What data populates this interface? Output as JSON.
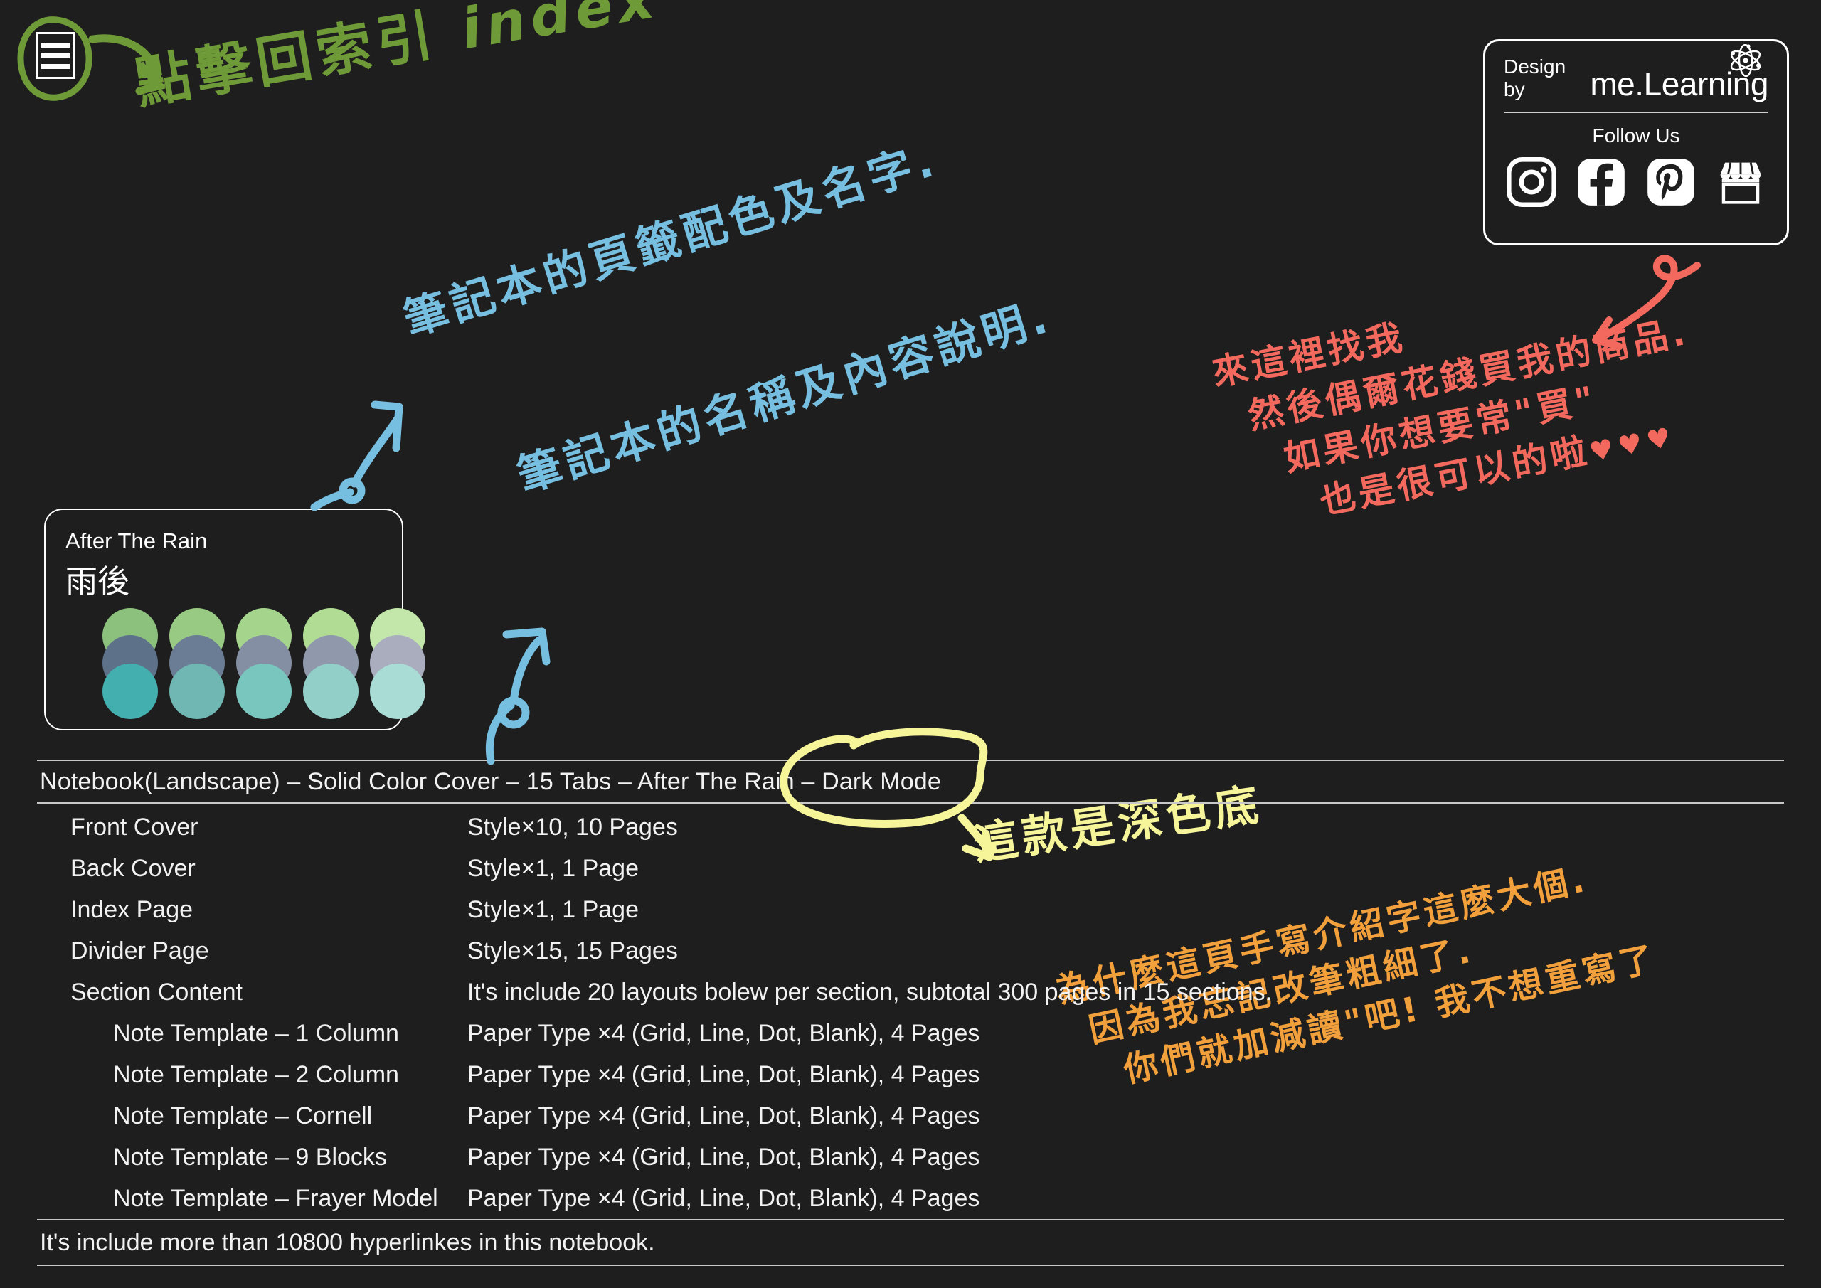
{
  "index_button": {
    "name": "index-menu-button",
    "bars": 3
  },
  "annotations": {
    "green": {
      "text": "點擊回索引 ",
      "en": "index",
      "color": "#6f9a38"
    },
    "blue_1": {
      "text": "筆記本的頁籤配色及名字.",
      "color": "#76bfe0"
    },
    "blue_2": {
      "text": "筆記本的名稱及內容說明.",
      "color": "#76bfe0"
    },
    "red": {
      "color": "#f4695e",
      "lines": [
        "來這裡找我",
        "然後偶爾花錢買我的商品.",
        "如果你想要常\"買\"",
        "也是很可以的啦"
      ],
      "hearts": "♥♥♥"
    },
    "yellow": {
      "text": "這款是深色底",
      "color": "#f6f59a"
    },
    "orange": {
      "color": "#f2a03c",
      "lines": [
        "為什麼這頁手寫介紹字這麼大個.",
        "因為我忘記改筆粗細了.",
        "你們就加減讀\"吧! 我不想重寫了"
      ]
    }
  },
  "brand": {
    "design_by": "Design by",
    "name": "me.Learning",
    "follow_us": "Follow Us",
    "socials": [
      "instagram-icon",
      "facebook-icon",
      "pinterest-icon",
      "storefront-icon"
    ]
  },
  "palette": {
    "name_en": "After The Rain",
    "name_zh": "雨後",
    "columns": [
      {
        "top": "#8cc07d",
        "mid": "#5d7289",
        "bottom": "#43afaf"
      },
      {
        "top": "#99ca84",
        "mid": "#6b7d94",
        "bottom": "#70b6b2"
      },
      {
        "top": "#a5d48c",
        "mid": "#848fa4",
        "bottom": "#79c6bf"
      },
      {
        "top": "#b0dc94",
        "mid": "#9099ab",
        "bottom": "#92cfc9"
      },
      {
        "top": "#c3e6ab",
        "mid": "#a9adbe",
        "bottom": "#aadcd6"
      }
    ]
  },
  "spec": {
    "title": "Notebook(Landscape) – Solid Color Cover – 15 Tabs – After The Rain – Dark Mode",
    "rows": [
      {
        "level": 1,
        "key": "Front Cover",
        "value": "Style×10, 10 Pages"
      },
      {
        "level": 1,
        "key": "Back Cover",
        "value": "Style×1, 1 Page"
      },
      {
        "level": 1,
        "key": "Index Page",
        "value": "Style×1, 1 Page"
      },
      {
        "level": 1,
        "key": "Divider Page",
        "value": "Style×15, 15 Pages"
      },
      {
        "level": 1,
        "key": "Section Content",
        "value": "It's include 20 layouts bolew per section, subtotal 300 pages in 15 sections."
      },
      {
        "level": 2,
        "key": "Note Template – 1 Column",
        "value": "Paper Type ×4 (Grid, Line, Dot, Blank), 4 Pages"
      },
      {
        "level": 2,
        "key": "Note Template – 2 Column",
        "value": "Paper Type ×4 (Grid, Line, Dot, Blank), 4 Pages"
      },
      {
        "level": 2,
        "key": "Note Template – Cornell",
        "value": "Paper Type ×4 (Grid, Line, Dot, Blank), 4 Pages"
      },
      {
        "level": 2,
        "key": "Note Template – 9 Blocks",
        "value": "Paper Type ×4 (Grid, Line, Dot, Blank), 4 Pages"
      },
      {
        "level": 2,
        "key": "Note Template – Frayer Model",
        "value": "Paper Type ×4 (Grid, Line, Dot, Blank), 4 Pages"
      }
    ],
    "footer": "It's include more than 10800 hyperlinkes in this notebook."
  },
  "theme": {
    "background": "#1e1e1e",
    "text": "#f2f2f2",
    "rule": "#c8c8c8"
  }
}
